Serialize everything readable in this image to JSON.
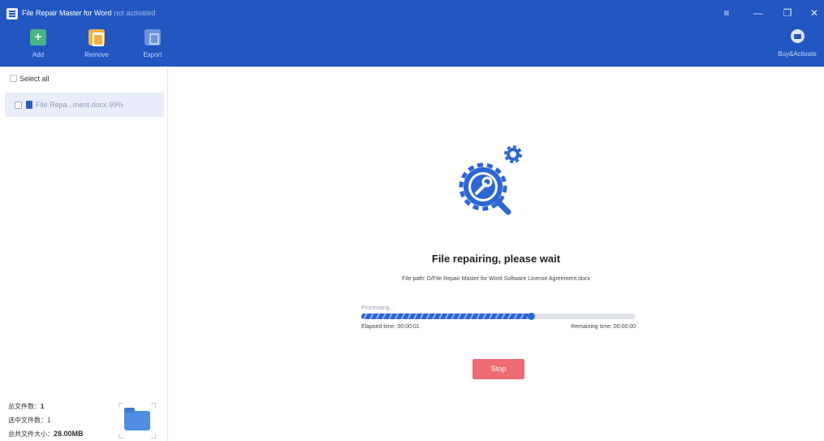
{
  "window": {
    "title": "File Repair Master for Word",
    "activation_status": "not activated",
    "controls": {
      "menu": "≡",
      "minimize": "—",
      "restore": "❐",
      "close": "✕"
    }
  },
  "toolbar": {
    "add_label": "Add",
    "remove_label": "Remove",
    "export_label": "Export",
    "buy_label": "Buy&Activate",
    "icons": {
      "add": "add-file-icon",
      "remove": "trash-icon",
      "export": "export-icon",
      "buy": "cart-icon"
    }
  },
  "sidebar": {
    "select_all_label": "Select all",
    "files": [
      {
        "name": "File Repa...ment.docx",
        "progress_text": "99%"
      }
    ],
    "stats": {
      "total_files_label": "总文件数：",
      "total_files_value": "1",
      "selected_files_label": "选中文件数：",
      "selected_files_value": "1",
      "total_size_label": "总共文件大小：",
      "total_size_value": "28.00MB"
    }
  },
  "main": {
    "status_title": "File repairing, please wait",
    "file_path": "File path: D/File Repair Master for Word Software License Agreement.docx",
    "processing_label": "Processing...",
    "progress_fraction": 0.62,
    "elapsed_label": "Elapsed time: 00:00:01",
    "remaining_label": "Remaining time: 00:00:00",
    "stop_label": "Stop"
  },
  "colors": {
    "brand": "#2257c2",
    "accent": "#2c66d2",
    "stop": "#ef6c75",
    "add": "#45b583",
    "remove": "#f2b046"
  }
}
